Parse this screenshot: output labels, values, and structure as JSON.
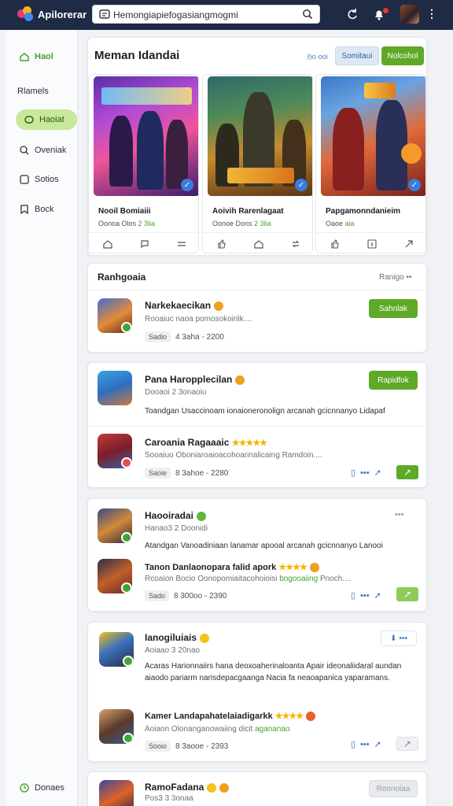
{
  "header": {
    "app_name": "Apilorerar",
    "search_value": "Hemongiapiefogasiangmogmi",
    "colors": {
      "bar": "#1f2a44",
      "accent": "#5fa928"
    }
  },
  "sidebar": {
    "home": "Haol",
    "section": "Rlamels",
    "items": [
      {
        "label": "Haoiat",
        "icon": "chat-icon",
        "active": true
      },
      {
        "label": "Oveniak",
        "icon": "search-icon"
      },
      {
        "label": "Sotios",
        "icon": "square-icon"
      },
      {
        "label": "Bock",
        "icon": "bookmark-icon"
      }
    ],
    "footer": "Donaes"
  },
  "featured": {
    "title": "Meman Idandai",
    "link": "ℌo·ooi",
    "secondary_button": "Somitaui",
    "primary_button": "Nolcohol",
    "games": [
      {
        "title": "Nooil Bomiaiii",
        "stats_prefix": "Oonoa Olos",
        "stats_value": "2 3lia"
      },
      {
        "title": "Aoivih Rarenlagaat",
        "stats_prefix": "Oonoe Dons",
        "stats_value": "2 3lia"
      },
      {
        "title": "Papgamonndanieim",
        "stats_prefix": "Oaoe",
        "stats_value": "aia"
      }
    ]
  },
  "list_section": {
    "title": "Ranhgoaia",
    "right_label": "Ranigo  ••"
  },
  "apps": [
    {
      "title": "Narkekaecikan",
      "subtitle": "Rooaiuc naoa pomosokoiriik....",
      "tag": "Sadio",
      "meta": "4 3aha - 2200",
      "button": "Sahnlak"
    },
    {
      "title": "Pana Haropplecilan",
      "subtitle": "Dooaoi 2 3onaoiu",
      "button": "Rapidfok",
      "desc": "Toandgan Usaccinoam ionaioneronolign arcanah gcicnnanyo Lidapaf"
    },
    {
      "title": "Caroania Ragaaaic",
      "rating": "★★★★★",
      "subtitle": "Sooaiuo Oboniaroaioacohoarinalicaing Ramdoin....",
      "tag": "Saoie",
      "meta": "8 3ahoe - 2280"
    },
    {
      "title": "Haooiradai",
      "subtitle": "Hanao3 2 Doonidi",
      "desc": "Atandgan Vanoadiniaan lanamar apooal arcanah gcicnnanyo Lanooi"
    },
    {
      "title": "Tanon Danlaonopara falid apork",
      "rating": "★★★★",
      "subtitle": "Rcoaion Bocio Oonopomiaitacohoioisi",
      "sub_highlight": "bogooaiing",
      "sub_tail": "Pnoch....",
      "tag": "Sado",
      "meta": "8 300oo - 2390"
    },
    {
      "title": "Ianogiluiais",
      "subtitle": "Aoiaao 3 20nao",
      "desc": "Acaras Harionnaiirs hana deoxoaherinaloanta Apair ideonaliidaral aundan aiaodo pariarm narisdepacgaanga Nacia fa neaoapanica yaparamans."
    },
    {
      "title": "Kamer Landapahatelaiadigarkk",
      "rating": "★★★★",
      "subtitle": "Aoiaon Olonanganowaiing dicit",
      "sub_highlight": "agananao",
      "tag": "Sooio",
      "meta": "8 3aooe - 2393"
    },
    {
      "title": "RamoFadana",
      "subtitle": "Pos3 3 3onaa",
      "button": "Reonoiaa"
    }
  ]
}
